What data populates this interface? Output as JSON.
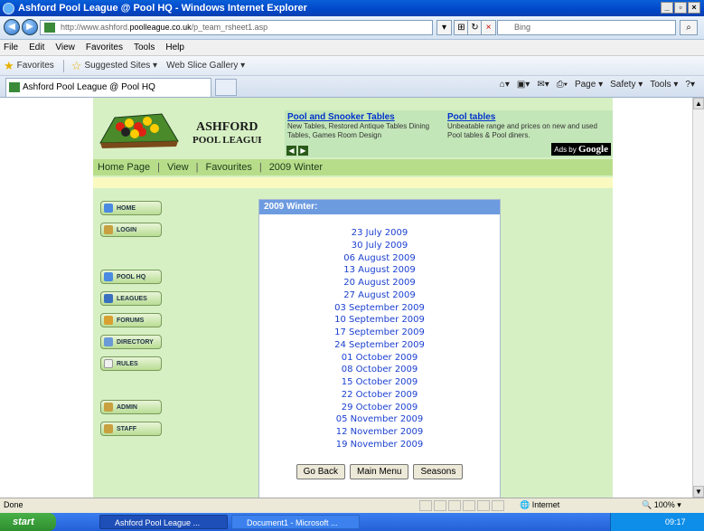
{
  "window": {
    "title": "Ashford Pool League @ Pool HQ - Windows Internet Explorer"
  },
  "address_bar": {
    "url_prefix": "http://www.ashford.",
    "url_domain": "poolleague.co.uk",
    "url_suffix": "/p_team_rsheet1.asp",
    "search_placeholder": "Bing"
  },
  "menu": [
    "File",
    "Edit",
    "View",
    "Favorites",
    "Tools",
    "Help"
  ],
  "favorites_bar": {
    "favorites_label": "Favorites",
    "items": [
      "Suggested Sites ▾",
      "Web Slice Gallery ▾"
    ]
  },
  "tab": {
    "title": "Ashford Pool League @ Pool HQ"
  },
  "command_bar": [
    "Page ▾",
    "Safety ▾",
    "Tools ▾"
  ],
  "page": {
    "logo_line1": "ASHFORD",
    "logo_line2": "POOL LEAGUE",
    "ads": [
      {
        "title": "Pool and Snooker Tables",
        "desc": "New Tables, Restored Antique Tables Dining Tables, Games Room Design"
      },
      {
        "title": "Pool tables",
        "desc": "Unbeatable range and prices on new and used Pool tables & Pool diners."
      }
    ],
    "ads_by": "Ads by",
    "ads_brand": "Google",
    "breadcrumb": [
      "Home Page",
      "View",
      "Favourites",
      "2009 Winter"
    ],
    "sidebar": [
      "HOME",
      "LOGIN",
      "POOL HQ",
      "LEAGUES",
      "FORUMS",
      "DIRECTORY",
      "RULES",
      "ADMIN",
      "STAFF"
    ],
    "panel_title": "2009 Winter:",
    "dates": [
      "23 July 2009",
      "30 July 2009",
      "06 August 2009",
      "13 August 2009",
      "20 August 2009",
      "27 August 2009",
      "03 September 2009",
      "10 September 2009",
      "17 September 2009",
      "24 September 2009",
      "01 October 2009",
      "08 October 2009",
      "15 October 2009",
      "22 October 2009",
      "29 October 2009",
      "05 November 2009",
      "12 November 2009",
      "19 November 2009"
    ],
    "buttons": {
      "back": "Go Back",
      "main": "Main Menu",
      "seasons": "Seasons"
    }
  },
  "status_bar": {
    "status": "Done",
    "zone": "Internet",
    "zoom": "100%"
  },
  "taskbar": {
    "start": "start",
    "tasks": [
      "Ashford Pool League ...",
      "Document1 - Microsoft ..."
    ],
    "clock": "09:17"
  }
}
